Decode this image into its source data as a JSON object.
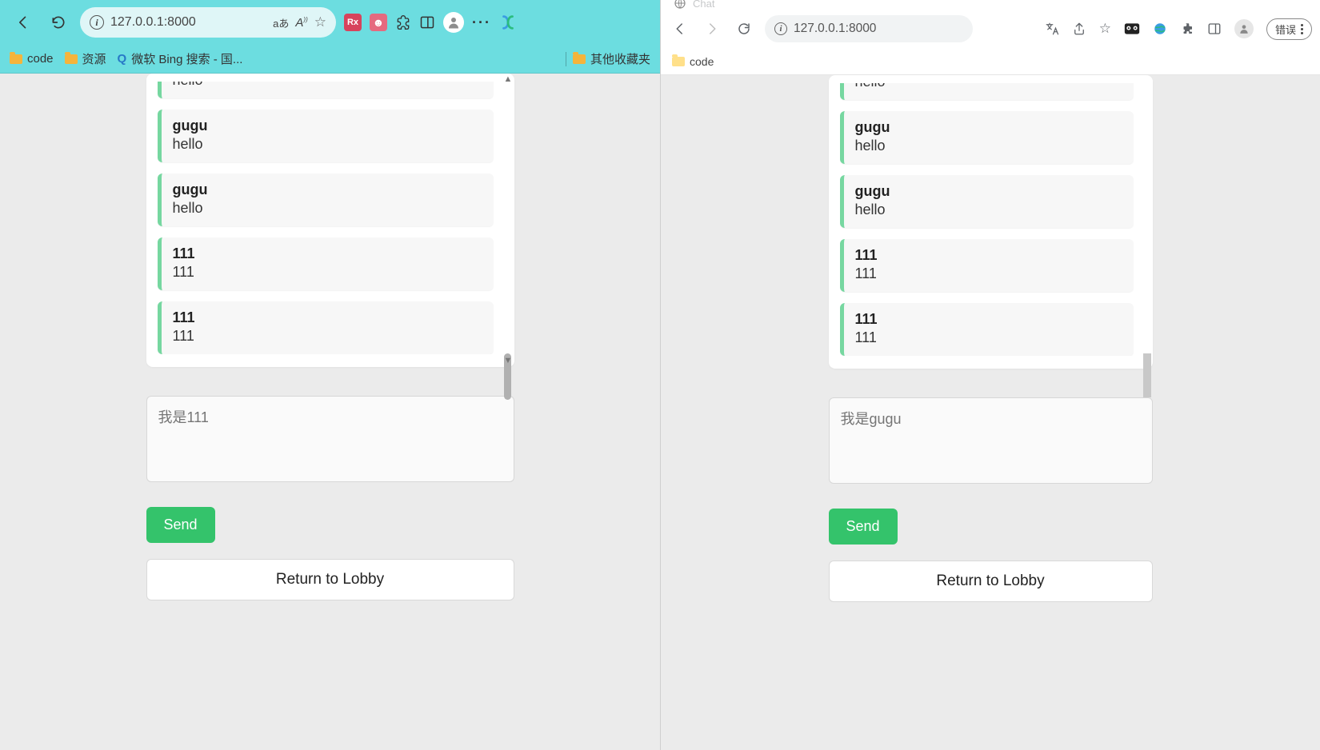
{
  "left_browser": {
    "url": "127.0.0.1:8000",
    "addr_extra": {
      "lang": "aあ",
      "aA": "A))",
      "star": "☆"
    },
    "bookmarks": {
      "code": "code",
      "resources": "资源",
      "bing": "微软 Bing 搜索 - 国...",
      "other": "其他收藏夹"
    }
  },
  "right_browser": {
    "tab_title": "Chat",
    "url": "127.0.0.1:8000",
    "error_label": "错误",
    "bookmark_code": "code"
  },
  "chat_left": {
    "messages": [
      {
        "sender": "",
        "body": "hello"
      },
      {
        "sender": "gugu",
        "body": "hello"
      },
      {
        "sender": "gugu",
        "body": "hello"
      },
      {
        "sender": "111",
        "body": "111"
      },
      {
        "sender": "111",
        "body": "111"
      }
    ],
    "input_placeholder": "我是111",
    "send_label": "Send",
    "return_label": "Return to Lobby"
  },
  "chat_right": {
    "messages": [
      {
        "sender": "",
        "body": "hello"
      },
      {
        "sender": "gugu",
        "body": "hello"
      },
      {
        "sender": "gugu",
        "body": "hello"
      },
      {
        "sender": "111",
        "body": "111"
      },
      {
        "sender": "111",
        "body": "111"
      }
    ],
    "input_placeholder": "我是gugu",
    "send_label": "Send",
    "return_label": "Return to Lobby"
  }
}
